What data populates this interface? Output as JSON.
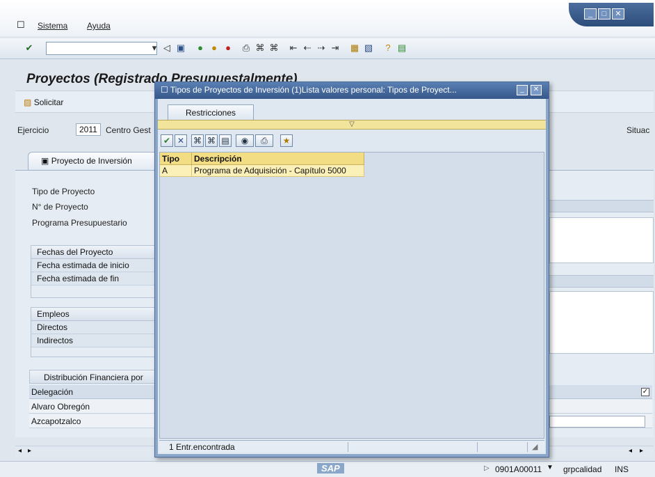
{
  "menu": {
    "icon": "menu-icon",
    "items": [
      "Sistema",
      "Ayuda"
    ]
  },
  "toolbar": {
    "command_value": ""
  },
  "page": {
    "title": "Proyectos (Registrado Presupuestalmente)",
    "solicitar_label": "Solicitar",
    "ejercicio_label": "Ejercicio",
    "ejercicio_value": "2011",
    "centro_label": "Centro Gest",
    "situac_label": "Situac",
    "tab_label": "Proyecto de Inversión",
    "fields": [
      "Tipo de Proyecto",
      "N° de Proyecto",
      "Programa Presupuestario"
    ],
    "fechas": {
      "title": "Fechas del Proyecto",
      "items": [
        "Fecha estimada de inicio",
        "Fecha estimada de fin"
      ]
    },
    "empleos": {
      "title": "Empleos",
      "items": [
        "Directos",
        "Indirectos"
      ]
    },
    "distribucion": {
      "title": "Distribución Financiera por",
      "header": "Delegación",
      "rows": [
        "Alvaro Obregón",
        "Azcapotzalco"
      ]
    }
  },
  "dialog": {
    "title": "Tipos de Proyectos de Inversión (1)Lista valores personal: Tipos de Proyect...",
    "tab": "Restricciones",
    "columns": [
      "Tipo",
      "Descripción"
    ],
    "rows": [
      {
        "tipo": "A",
        "descripcion": "Programa de Adquisición - Capítulo 5000"
      }
    ],
    "status": "1 Entr.encontrada"
  },
  "statusbar": {
    "logo": "SAP",
    "session": "0901A00011",
    "client": "grpcalidad",
    "mode": "INS"
  }
}
